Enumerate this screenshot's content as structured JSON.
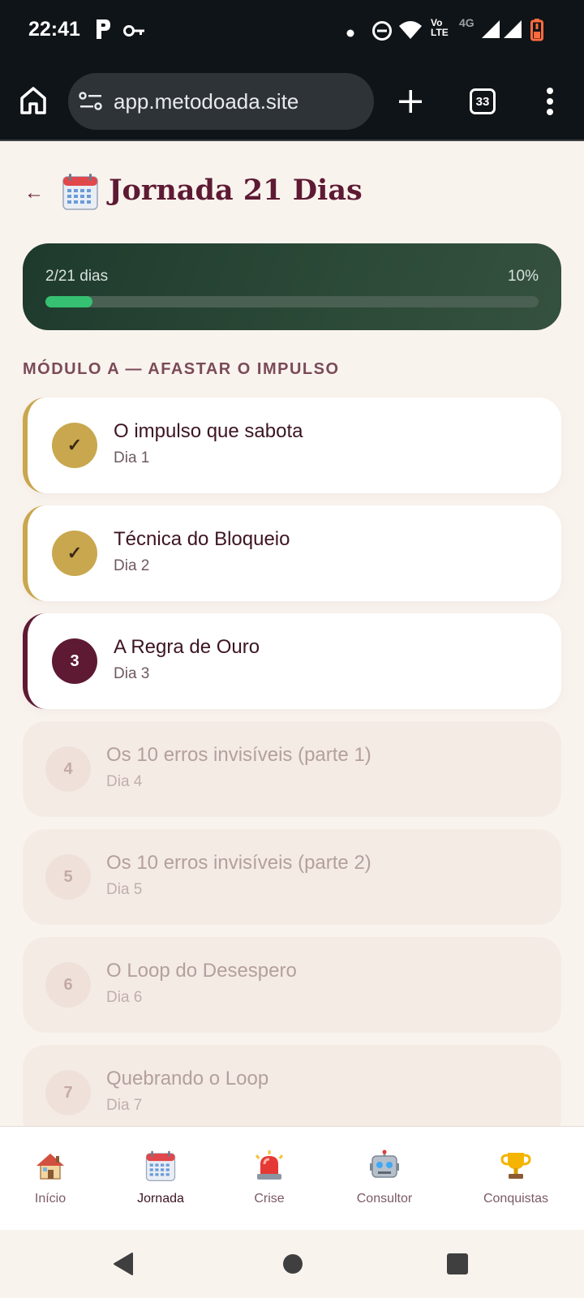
{
  "status_bar": {
    "time": "22:41",
    "network_label": "4G",
    "volte_top": "Vo",
    "volte_bottom": "LTE",
    "icons": [
      "p-app-icon",
      "key-icon",
      "dot-icon",
      "do-not-disturb-icon",
      "wifi-icon",
      "volte-icon",
      "signal-icon",
      "signal-icon",
      "battery-low-icon"
    ]
  },
  "browser": {
    "url": "app.metodoada.site",
    "tab_count": "33",
    "icons": [
      "home-icon",
      "site-settings-icon",
      "plus-icon",
      "tabs-icon",
      "more-vert-icon"
    ]
  },
  "page": {
    "back_label": "←",
    "title": "Jornada 21 Dias",
    "title_icon": "calendar-icon"
  },
  "progress": {
    "days_label": "2/21 dias",
    "percent_label": "10%",
    "fraction": 0.095
  },
  "module": {
    "title": "MÓDULO A — AFASTAR O IMPULSO"
  },
  "lessons": [
    {
      "badge": "✓",
      "title": "O impulso que sabota",
      "day": "Dia 1",
      "state": "done"
    },
    {
      "badge": "✓",
      "title": "Técnica do Bloqueio",
      "day": "Dia 2",
      "state": "done"
    },
    {
      "badge": "3",
      "title": "A Regra de Ouro",
      "day": "Dia 3",
      "state": "current"
    },
    {
      "badge": "4",
      "title": "Os 10 erros invisíveis (parte 1)",
      "day": "Dia 4",
      "state": "locked"
    },
    {
      "badge": "5",
      "title": "Os 10 erros invisíveis (parte 2)",
      "day": "Dia 5",
      "state": "locked"
    },
    {
      "badge": "6",
      "title": "O Loop do Desespero",
      "day": "Dia 6",
      "state": "locked"
    },
    {
      "badge": "7",
      "title": "Quebrando o Loop",
      "day": "Dia 7",
      "state": "locked"
    }
  ],
  "nav": [
    {
      "label": "Início",
      "icon": "house-icon"
    },
    {
      "label": "Jornada",
      "icon": "calendar-icon"
    },
    {
      "label": "Crise",
      "icon": "siren-icon"
    },
    {
      "label": "Consultor",
      "icon": "robot-icon"
    },
    {
      "label": "Conquistas",
      "icon": "trophy-icon"
    }
  ],
  "system_nav": {
    "icons": [
      "back-triangle-icon",
      "home-circle-icon",
      "recents-square-icon"
    ]
  },
  "colors": {
    "accent": "#5e1a33",
    "gold": "#c9a74e",
    "progress_green": "#36c072",
    "card_dark_green": "#2c4a38",
    "background": "#f9f3ee"
  }
}
